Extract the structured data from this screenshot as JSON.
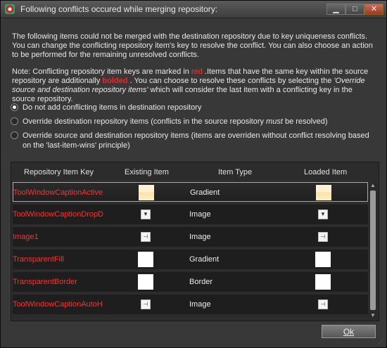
{
  "window": {
    "title": "Following conflicts occured while merging repository:",
    "controls": {
      "minimize": "▁",
      "maximize": "□",
      "close": "✕"
    }
  },
  "intro": "The following items could not be merged with the destination repository due to key uniqueness conflicts. You can change the conflicting repository item's key to resolve the conflict. You can also choose an action to be performed for the remaining unresolved conflicts.",
  "note": {
    "p1": "Note: Conflicting repository item keys are marked in ",
    "red_word": "red",
    "p2": " .Items that have the same key within the source repository are additionally ",
    "bold_word": "bolded",
    "p3": " . You can choose to resolve these conflicts by selecting the ",
    "italic": "'Override source and destination repository items'",
    "p4": " which will consider the last item with a conflicting key in the source repository."
  },
  "options": [
    {
      "label": "Do not add conflicting items in destination repository",
      "selected": true
    },
    {
      "label_a": "Override destination repository items (conflicts in the source repository ",
      "label_em": "must",
      "label_b": " be resolved)",
      "selected": false
    },
    {
      "label": "Override source and destination repository items (items are overriden without conflict resolving based on the 'last-item-wins' principle)",
      "selected": false
    }
  ],
  "grid": {
    "headers": {
      "key": "Repository Item Key",
      "existing": "Existing Item",
      "type": "Item Type",
      "loaded": "Loaded Item"
    },
    "rows": [
      {
        "key": "ToolWindowCaptionActive",
        "type": "Gradient",
        "swatch": "gradient"
      },
      {
        "key": "ToolWindowCaptionDropD",
        "type": "Image",
        "swatch": "dropdown-arrow-icon"
      },
      {
        "key": "Image1",
        "type": "Image",
        "swatch": "pin-icon"
      },
      {
        "key": "TransparentFill",
        "type": "Gradient",
        "swatch": "white"
      },
      {
        "key": "TransparentBorder",
        "type": "Border",
        "swatch": "white"
      },
      {
        "key": "ToolWindowCaptionAutoH",
        "type": "Image",
        "swatch": "pin-icon"
      }
    ]
  },
  "ok_label": "Ok"
}
